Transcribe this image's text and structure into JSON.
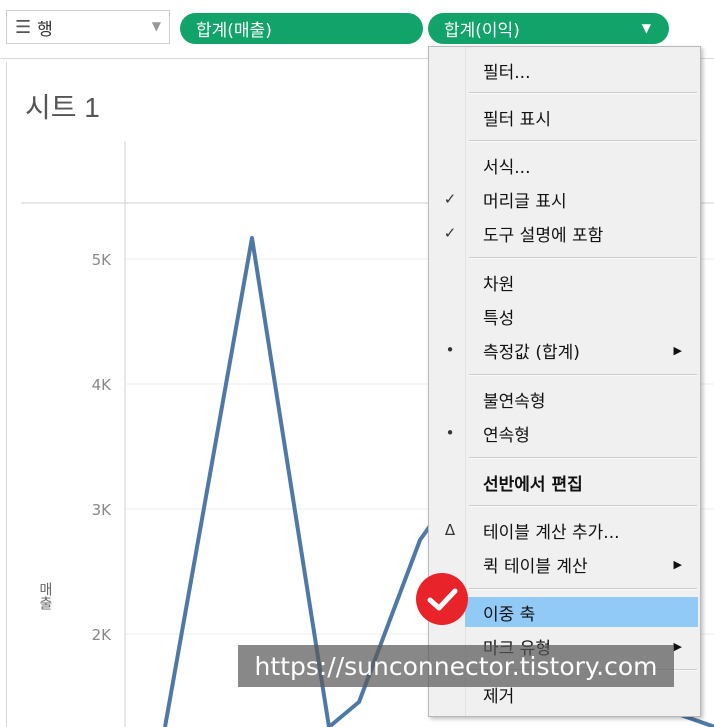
{
  "shelf": {
    "label": "행",
    "label_icon": "rows-list-icon",
    "pills": [
      {
        "label": "합계(매출)"
      },
      {
        "label": "합계(이익)"
      }
    ]
  },
  "sheet": {
    "title": "시트 1",
    "axis_title": "매출"
  },
  "chart_data": {
    "type": "line",
    "y_ticks": [
      "5K",
      "4K",
      "3K",
      "2K"
    ],
    "series": [
      {
        "values": [
          null,
          5150,
          null,
          2750,
          null
        ]
      }
    ],
    "color": "#4e79a7"
  },
  "menu": {
    "items": [
      {
        "label": "필터...",
        "mark": ""
      },
      {
        "label": "필터 표시",
        "mark": ""
      },
      {
        "label": "서식...",
        "mark": ""
      },
      {
        "label": "머리글 표시",
        "mark": "✓"
      },
      {
        "label": "도구 설명에 포함",
        "mark": "✓"
      },
      {
        "label": "차원",
        "mark": ""
      },
      {
        "label": "특성",
        "mark": ""
      },
      {
        "label": "측정값 (합계)",
        "mark": "•",
        "submenu": true
      },
      {
        "label": "불연속형",
        "mark": ""
      },
      {
        "label": "연속형",
        "mark": "•"
      },
      {
        "label": "선반에서 편집",
        "mark": ""
      },
      {
        "label": "테이블 계산 추가...",
        "mark": "Δ"
      },
      {
        "label": "퀵 테이블 계산",
        "mark": "",
        "submenu": true
      },
      {
        "label": "이중 축",
        "mark": ""
      },
      {
        "label": "마크 유형",
        "mark": "",
        "submenu": true
      },
      {
        "label": "제거",
        "mark": ""
      }
    ]
  },
  "watermark": "https://sunconnector.tistory.com",
  "colors": {
    "pill": "#12a36b",
    "highlight": "#91c9f7",
    "badge": "#e8232a",
    "line": "#4e79a7"
  }
}
